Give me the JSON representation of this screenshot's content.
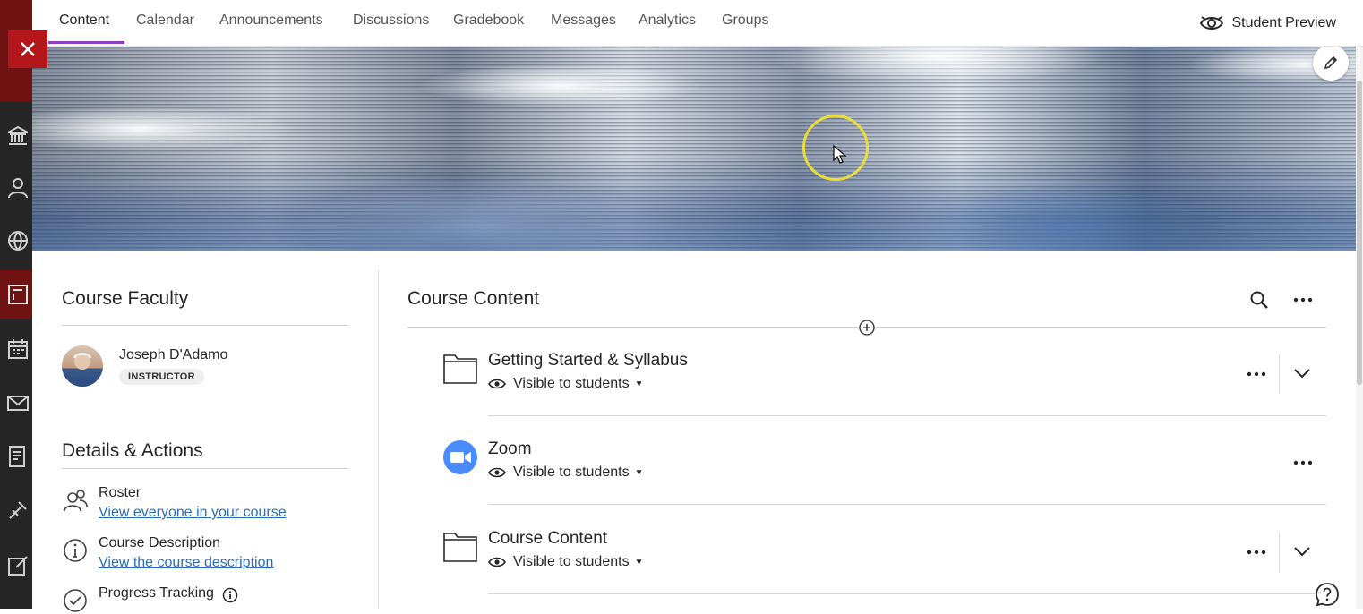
{
  "tabs": [
    {
      "label": "Content",
      "active": true
    },
    {
      "label": "Calendar"
    },
    {
      "label": "Announcements"
    },
    {
      "label": "Discussions"
    },
    {
      "label": "Gradebook"
    },
    {
      "label": "Messages"
    },
    {
      "label": "Analytics"
    },
    {
      "label": "Groups"
    }
  ],
  "student_preview_label": "Student Preview",
  "faculty": {
    "title": "Course Faculty",
    "name": "Joseph D'Adamo",
    "role": "INSTRUCTOR"
  },
  "details": {
    "title": "Details & Actions",
    "items": [
      {
        "title": "Roster",
        "link": "View everyone in your course",
        "icon": "roster-icon"
      },
      {
        "title": "Course Description",
        "link": "View the course description",
        "icon": "info-icon"
      },
      {
        "title": "Progress Tracking",
        "icon": "check-circle-icon"
      }
    ]
  },
  "course_content": {
    "title": "Course Content",
    "items": [
      {
        "title": "Getting Started & Syllabus",
        "visibility": "Visible to students",
        "icon": "folder-icon"
      },
      {
        "title": "Zoom",
        "visibility": "Visible to students",
        "icon": "zoom-icon"
      },
      {
        "title": "Course Content",
        "visibility": "Visible to students",
        "icon": "folder-icon"
      }
    ]
  },
  "colors": {
    "accent": "#8f3fc4",
    "link": "#2a6ebb",
    "close_button": "#b3161b",
    "rail": "#262626"
  }
}
